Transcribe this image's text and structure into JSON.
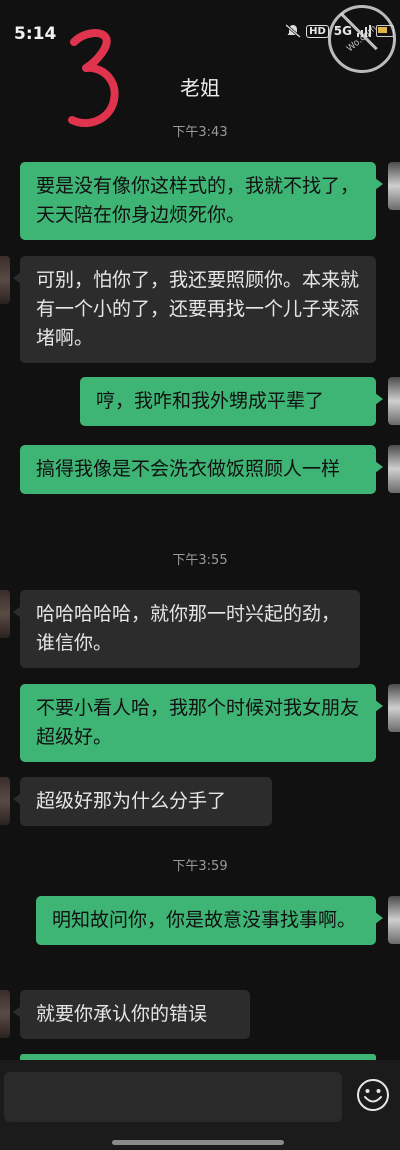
{
  "status_bar": {
    "time": "5:14",
    "hd_label": "HD",
    "signal_label": "5G"
  },
  "watermark_text": "Wo.com",
  "header": {
    "title": "老姐",
    "scribble_digit": "3"
  },
  "messages": [
    {
      "type": "time",
      "text": "下午3:43"
    },
    {
      "type": "me",
      "text": "要是没有像你这样式的，我就不找了，天天陪在你身边烦死你。"
    },
    {
      "type": "other",
      "text": "可别，怕你了，我还要照顾你。本来就有一个小的了，还要再找一个儿子来添堵啊。"
    },
    {
      "type": "me",
      "text": "哼，我咋和我外甥成平辈了"
    },
    {
      "type": "me",
      "text": "搞得我像是不会洗衣做饭照顾人一样"
    },
    {
      "type": "time",
      "text": "下午3:55"
    },
    {
      "type": "other",
      "text": "哈哈哈哈哈，就你那一时兴起的劲，谁信你。"
    },
    {
      "type": "me",
      "text": "不要小看人哈，我那个时候对我女朋友超级好。"
    },
    {
      "type": "other",
      "text": "超级好那为什么分手了"
    },
    {
      "type": "time",
      "text": "下午3:59"
    },
    {
      "type": "me",
      "text": "明知故问你，你是故意没事找事啊。"
    },
    {
      "type": "other",
      "text": "就要你承认你的错误"
    }
  ],
  "input": {
    "value": "",
    "placeholder": ""
  },
  "icons": {
    "emoji": "smiley-icon",
    "mute": "bell-off-icon",
    "battery": "battery-icon"
  },
  "colors": {
    "my_bubble": "#3eb575",
    "other_bubble": "#2c2c2c",
    "background": "#111111",
    "scribble": "#e0344e"
  }
}
